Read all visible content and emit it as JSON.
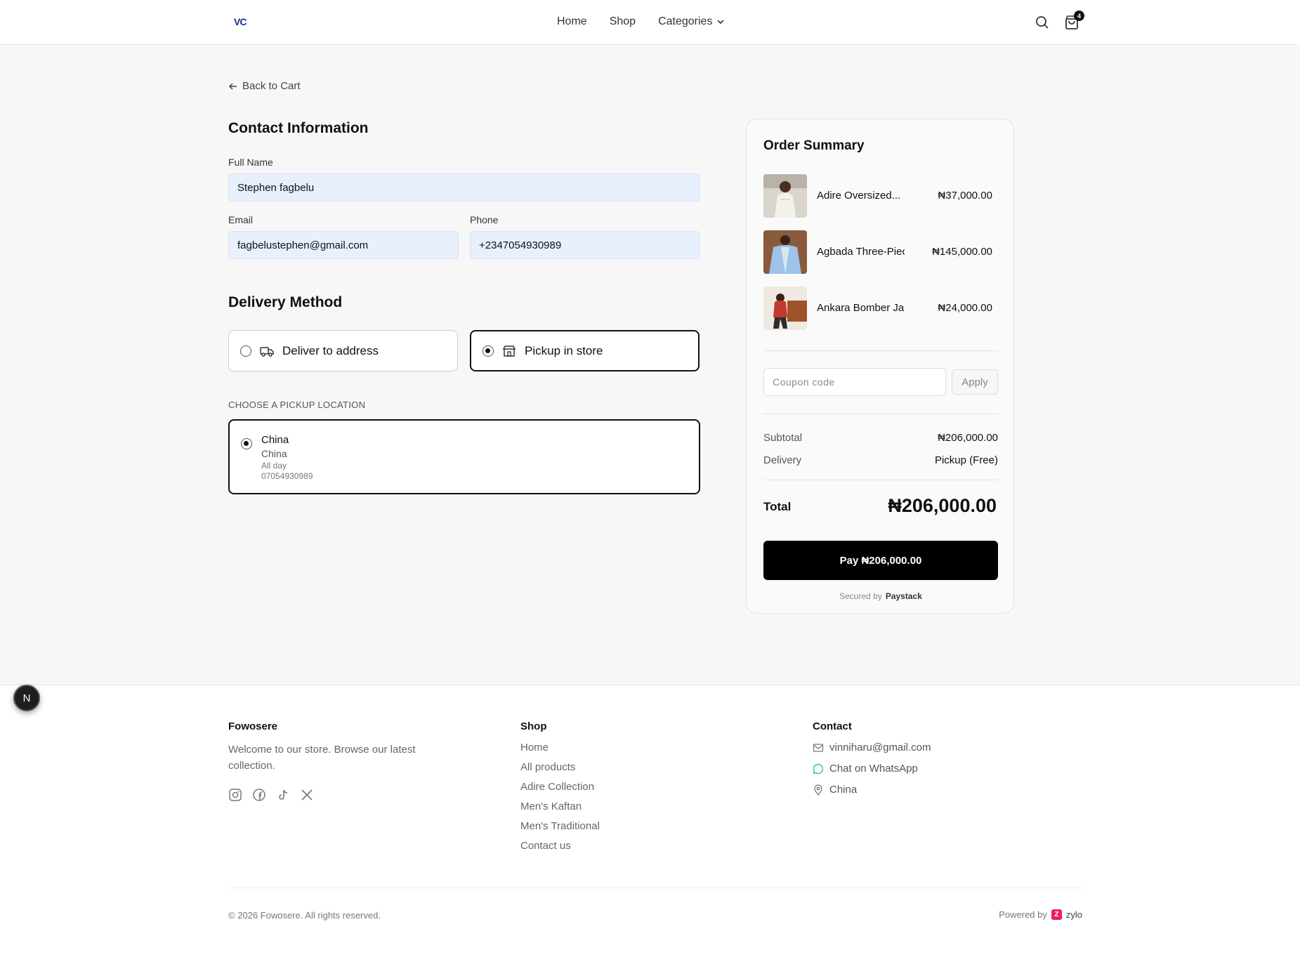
{
  "header": {
    "logo": "VC",
    "nav": [
      "Home",
      "Shop",
      "Categories"
    ],
    "cart_count": "4"
  },
  "back_link": "Back to Cart",
  "contact": {
    "title": "Contact Information",
    "full_name_label": "Full Name",
    "full_name": "Stephen fagbelu",
    "email_label": "Email",
    "email": "fagbelustephen@gmail.com",
    "phone_label": "Phone",
    "phone": "+2347054930989"
  },
  "delivery": {
    "title": "Delivery Method",
    "options": [
      {
        "label": "Deliver to address",
        "selected": false
      },
      {
        "label": "Pickup in store",
        "selected": true
      }
    ],
    "pickup_heading": "CHOOSE A PICKUP LOCATION",
    "location": {
      "name": "China",
      "city": "China",
      "hours": "All day",
      "phone": "07054930989"
    }
  },
  "summary": {
    "title": "Order Summary",
    "items": [
      {
        "name": "Adire Oversized...",
        "price": "₦37,000.00"
      },
      {
        "name": "Agbada Three-Piec...",
        "price": "₦145,000.00"
      },
      {
        "name": "Ankara Bomber Jacket",
        "price": "₦24,000.00"
      }
    ],
    "coupon_placeholder": "Coupon  code",
    "apply_label": "Apply",
    "subtotal_label": "Subtotal",
    "subtotal": "₦206,000.00",
    "delivery_label": "Delivery",
    "delivery_value": "Pickup (Free)",
    "total_label": "Total",
    "total": "₦206,000.00",
    "pay_label": "Pay ₦206,000.00",
    "secured_by": "Secured by",
    "provider": "Paystack"
  },
  "floating_badge": "N",
  "footer": {
    "brand": "Fowosere",
    "description": "Welcome to our store. Browse our latest collection.",
    "social_icons": [
      "instagram-icon",
      "facebook-icon",
      "tiktok-icon",
      "x-icon"
    ],
    "shop_title": "Shop",
    "shop_links": [
      "Home",
      "All products",
      "Adire Collection",
      "Men's Kaftan",
      "Men's Traditional",
      "Contact us"
    ],
    "contact_title": "Contact",
    "contact_email": "vinniharu@gmail.com",
    "contact_whatsapp": "Chat on WhatsApp",
    "contact_location": "China",
    "copyright": "© 2026 Fowosere. All rights reserved.",
    "powered_by": "Powered by",
    "powered_brand": "zylo",
    "powered_logo": "Z"
  },
  "colors": {
    "accent": "#000000",
    "input_bg": "#e8effd",
    "whatsapp": "#25d366",
    "zylo": "#e91e63"
  }
}
